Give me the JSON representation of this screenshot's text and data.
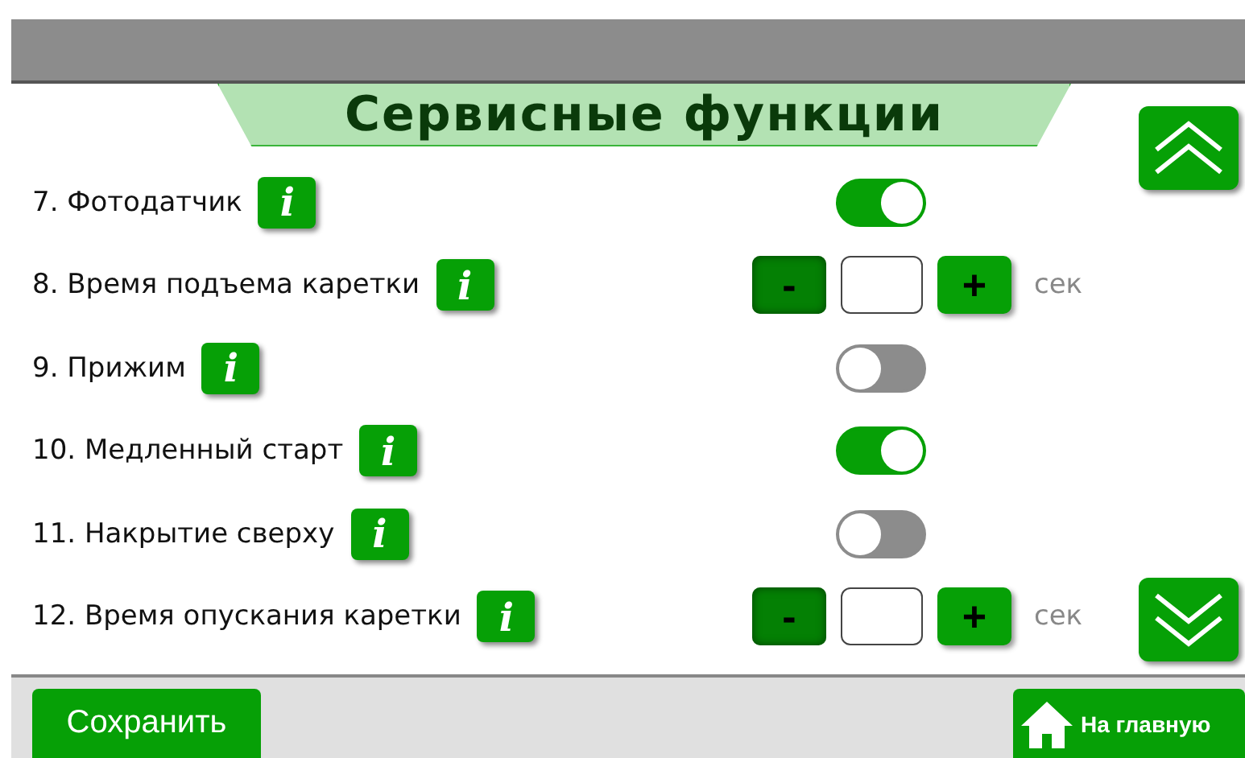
{
  "title": "Сервисные функции",
  "rows": [
    {
      "label": "7. Фотодатчик",
      "info": "i",
      "kind": "toggle",
      "on": true
    },
    {
      "label": "8. Время подъема каретки",
      "info": "i",
      "kind": "stepper",
      "minus": "-",
      "plus": "+",
      "unit": "сек"
    },
    {
      "label": "9. Прижим",
      "info": "i",
      "kind": "toggle",
      "on": false
    },
    {
      "label": "10. Медленный старт",
      "info": "i",
      "kind": "toggle",
      "on": true
    },
    {
      "label": "11. Накрытие сверху",
      "info": "i",
      "kind": "toggle",
      "on": false
    },
    {
      "label": "12. Время опускания каретки",
      "info": "i",
      "kind": "stepper",
      "minus": "-",
      "plus": "+",
      "unit": "сек"
    }
  ],
  "footer": {
    "save": "Сохранить",
    "home": "На главную"
  }
}
